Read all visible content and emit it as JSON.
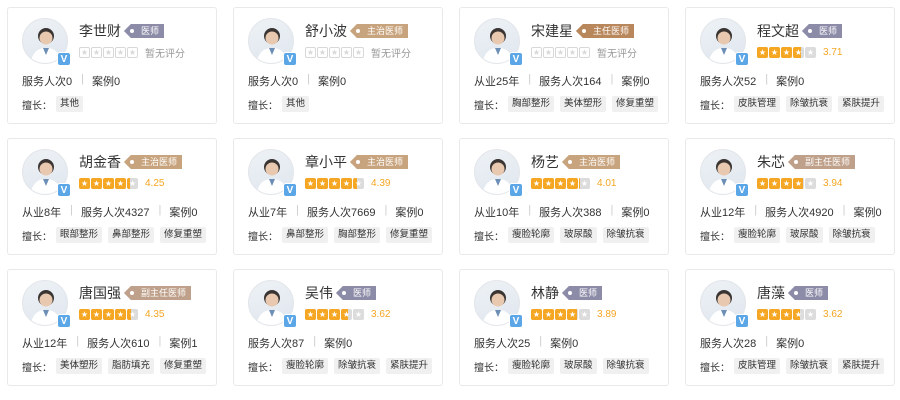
{
  "ui": {
    "tags_label": "擅长：",
    "no_rating": "暂无评分"
  },
  "colors": {
    "doctor": "#8c8ca8",
    "attending": "#c8a47e",
    "chief": "#b9875c",
    "vice_chief": "#bfa08a",
    "star": "#f5a623"
  },
  "doctors": [
    {
      "name": "李世财",
      "title": "医师",
      "title_color": "#8c8ca8",
      "rating": null,
      "score": "暂无评分",
      "stats": [
        "服务人次0",
        "案例0"
      ],
      "tags": [
        "其他"
      ]
    },
    {
      "name": "舒小波",
      "title": "主治医师",
      "title_color": "#c8a47e",
      "rating": null,
      "score": "暂无评分",
      "stats": [
        "服务人次0",
        "案例0"
      ],
      "tags": [
        "其他"
      ]
    },
    {
      "name": "宋建星",
      "title": "主任医师",
      "title_color": "#b9875c",
      "rating": null,
      "score": "暂无评分",
      "stats": [
        "从业25年",
        "服务人次164",
        "案例0"
      ],
      "tags": [
        "胸部整形",
        "美体塑形",
        "修复重塑"
      ]
    },
    {
      "name": "程文超",
      "title": "医师",
      "title_color": "#8c8ca8",
      "rating": 3.71,
      "score": "3.71",
      "stats": [
        "服务人次52",
        "案例0"
      ],
      "tags": [
        "皮肤管理",
        "除皱抗衰",
        "紧肤提升"
      ]
    },
    {
      "name": "胡金香",
      "title": "主治医师",
      "title_color": "#c8a47e",
      "rating": 4.25,
      "score": "4.25",
      "stats": [
        "从业8年",
        "服务人次4327",
        "案例0"
      ],
      "tags": [
        "眼部整形",
        "鼻部整形",
        "修复重塑"
      ]
    },
    {
      "name": "章小平",
      "title": "主治医师",
      "title_color": "#c8a47e",
      "rating": 4.39,
      "score": "4.39",
      "stats": [
        "从业7年",
        "服务人次7669",
        "案例0"
      ],
      "tags": [
        "鼻部整形",
        "胸部整形",
        "修复重塑"
      ]
    },
    {
      "name": "杨艺",
      "title": "主治医师",
      "title_color": "#c8a47e",
      "rating": 4.01,
      "score": "4.01",
      "stats": [
        "从业10年",
        "服务人次388",
        "案例0"
      ],
      "tags": [
        "瘦脸轮廓",
        "玻尿酸",
        "除皱抗衰"
      ]
    },
    {
      "name": "朱芯",
      "title": "副主任医师",
      "title_color": "#bfa08a",
      "rating": 3.94,
      "score": "3.94",
      "stats": [
        "从业12年",
        "服务人次4920",
        "案例0"
      ],
      "tags": [
        "瘦脸轮廓",
        "玻尿酸",
        "除皱抗衰"
      ]
    },
    {
      "name": "唐国强",
      "title": "副主任医师",
      "title_color": "#bfa08a",
      "rating": 4.35,
      "score": "4.35",
      "stats": [
        "从业12年",
        "服务人次610",
        "案例1"
      ],
      "tags": [
        "美体塑形",
        "脂肪填充",
        "修复重塑"
      ]
    },
    {
      "name": "吴伟",
      "title": "医师",
      "title_color": "#8c8ca8",
      "rating": 3.62,
      "score": "3.62",
      "stats": [
        "服务人次87",
        "案例0"
      ],
      "tags": [
        "瘦脸轮廓",
        "除皱抗衰",
        "紧肤提升"
      ]
    },
    {
      "name": "林静",
      "title": "医师",
      "title_color": "#8c8ca8",
      "rating": 3.89,
      "score": "3.89",
      "stats": [
        "服务人次25",
        "案例0"
      ],
      "tags": [
        "瘦脸轮廓",
        "玻尿酸",
        "除皱抗衰"
      ]
    },
    {
      "name": "唐藻",
      "title": "医师",
      "title_color": "#8c8ca8",
      "rating": 3.62,
      "score": "3.62",
      "stats": [
        "服务人次28",
        "案例0"
      ],
      "tags": [
        "皮肤管理",
        "除皱抗衰",
        "紧肤提升"
      ]
    }
  ]
}
